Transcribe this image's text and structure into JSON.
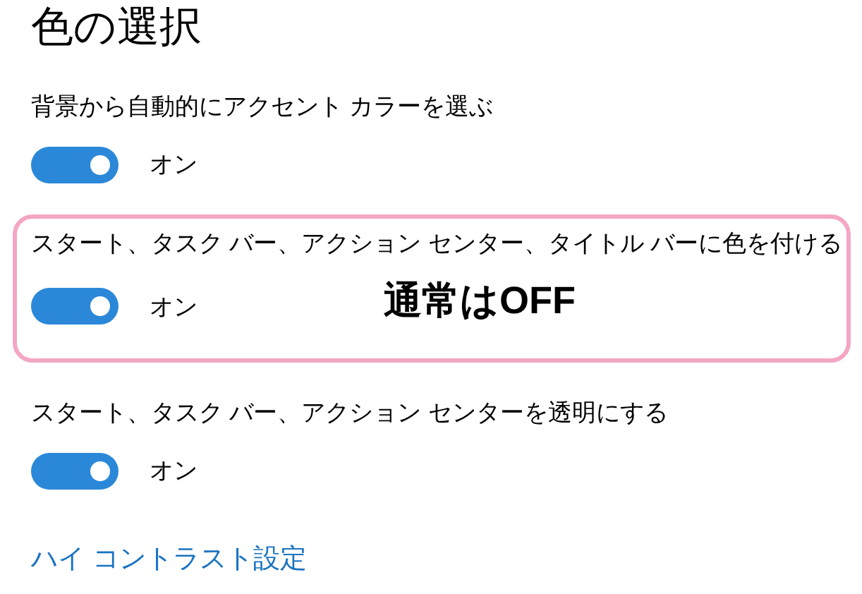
{
  "title": "色の選択",
  "settings": [
    {
      "label": "背景から自動的にアクセント カラーを選ぶ",
      "on": true,
      "state_text": "オン",
      "highlighted": false
    },
    {
      "label": "スタート、タスク バー、アクション センター、タイトル バーに色を付ける",
      "on": true,
      "state_text": "オン",
      "highlighted": true,
      "note": "通常はOFF"
    },
    {
      "label": "スタート、タスク バー、アクション センターを透明にする",
      "on": true,
      "state_text": "オン",
      "highlighted": false
    }
  ],
  "link": "ハイ コントラスト設定"
}
